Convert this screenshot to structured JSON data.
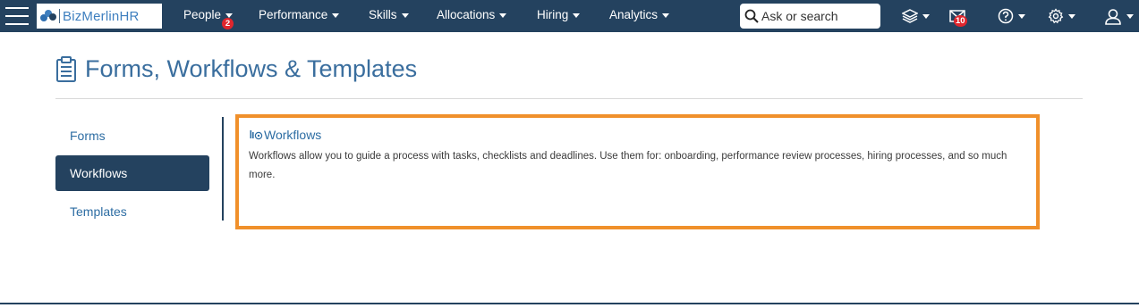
{
  "navbar": {
    "logo_text": "BizMerlinHR",
    "menu": [
      {
        "label": "People",
        "badge": "2"
      },
      {
        "label": "Performance"
      },
      {
        "label": "Skills"
      },
      {
        "label": "Allocations"
      },
      {
        "label": "Hiring"
      },
      {
        "label": "Analytics"
      }
    ],
    "search_placeholder": "Ask or search",
    "icons": [
      "layers-icon",
      "mail-icon",
      "help-icon",
      "settings-icon",
      "user-icon"
    ],
    "mail_badge": "10"
  },
  "page": {
    "title": "Forms, Workflows & Templates"
  },
  "sidebar": {
    "items": [
      {
        "label": "Forms",
        "active": false
      },
      {
        "label": "Workflows",
        "active": true
      },
      {
        "label": "Templates",
        "active": false
      }
    ]
  },
  "content": {
    "heading": "Workflows",
    "description": "Workflows allow you to guide a process with tasks, checklists and deadlines. Use them for: onboarding, performance review processes, hiring processes, and so much more."
  },
  "colors": {
    "navbar": "#24425f",
    "accent_blue": "#2d6da3",
    "highlight_border": "#f0902b",
    "badge_red": "#e0262d"
  }
}
